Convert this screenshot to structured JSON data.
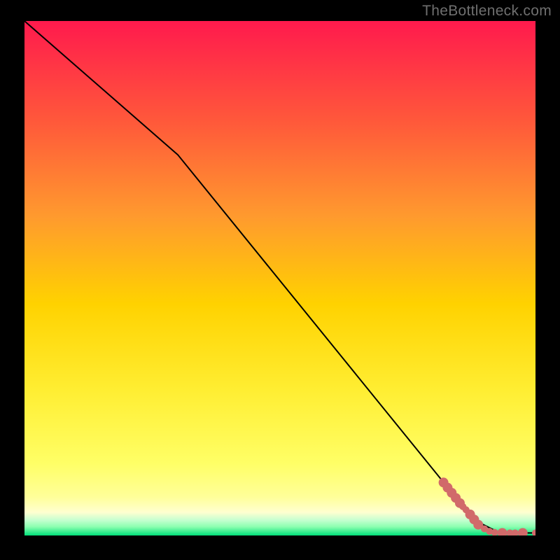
{
  "attribution": "TheBottleneck.com",
  "chart_data": {
    "type": "line",
    "title": "",
    "xlabel": "",
    "ylabel": "",
    "xlim": [
      0,
      100
    ],
    "ylim": [
      0,
      100
    ],
    "grid": false,
    "legend": false,
    "background_gradient": {
      "top": "#ff1a4d",
      "upper_mid": "#ff7a33",
      "mid": "#ffd200",
      "lower_mid": "#ffff66",
      "low": "#ffff99",
      "band_cream": "#ffffd0",
      "band_mint": "#8cffb0",
      "bottom": "#00e07a"
    },
    "series": [
      {
        "name": "curve",
        "color": "#000000",
        "stroke_width": 2,
        "x": [
          0,
          30,
          88,
          93,
          100
        ],
        "y": [
          100,
          74,
          3,
          0.5,
          0.5
        ]
      }
    ],
    "markers": {
      "name": "points",
      "color": "#d16a6a",
      "radius_small": 5,
      "radius_large": 7,
      "items": [
        {
          "x": 82.0,
          "y": 10.3,
          "r": "large"
        },
        {
          "x": 82.8,
          "y": 9.3,
          "r": "large"
        },
        {
          "x": 83.6,
          "y": 8.3,
          "r": "large"
        },
        {
          "x": 84.4,
          "y": 7.3,
          "r": "large"
        },
        {
          "x": 85.2,
          "y": 6.3,
          "r": "large"
        },
        {
          "x": 85.8,
          "y": 5.6,
          "r": "small"
        },
        {
          "x": 86.4,
          "y": 5.0,
          "r": "small"
        },
        {
          "x": 87.2,
          "y": 4.1,
          "r": "large"
        },
        {
          "x": 88.0,
          "y": 3.1,
          "r": "large"
        },
        {
          "x": 88.8,
          "y": 2.1,
          "r": "large"
        },
        {
          "x": 90.0,
          "y": 1.3,
          "r": "small"
        },
        {
          "x": 91.0,
          "y": 0.8,
          "r": "small"
        },
        {
          "x": 92.0,
          "y": 0.6,
          "r": "small"
        },
        {
          "x": 93.5,
          "y": 0.5,
          "r": "large"
        },
        {
          "x": 95.0,
          "y": 0.5,
          "r": "small"
        },
        {
          "x": 96.0,
          "y": 0.5,
          "r": "small"
        },
        {
          "x": 97.5,
          "y": 0.5,
          "r": "large"
        },
        {
          "x": 100.0,
          "y": 0.5,
          "r": "small"
        }
      ]
    }
  }
}
